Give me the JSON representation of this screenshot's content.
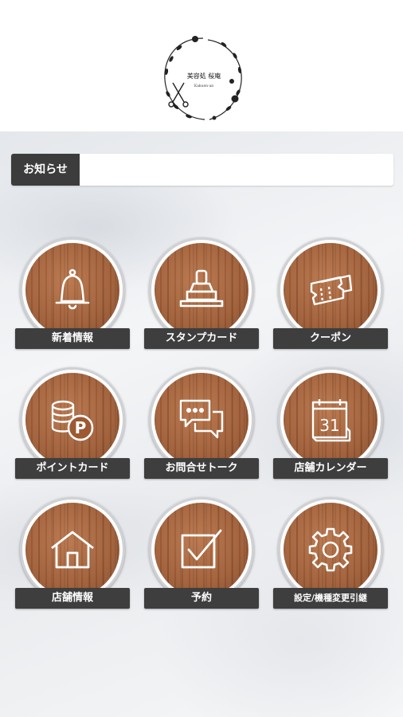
{
  "header": {
    "logo_icon": "floral-wreath-scissors-logo",
    "logo_text": "美容処 桜庵",
    "logo_subtext": "Kakuen-an"
  },
  "notice": {
    "label": "お知らせ",
    "content": ""
  },
  "menu": [
    {
      "label": "新着情報",
      "icon": "bell-icon"
    },
    {
      "label": "スタンプカード",
      "icon": "stamp-icon"
    },
    {
      "label": "クーポン",
      "icon": "coupon-icon"
    },
    {
      "label": "ポイントカード",
      "icon": "coins-point-icon"
    },
    {
      "label": "お問合せトーク",
      "icon": "chat-bubbles-icon"
    },
    {
      "label": "店舗カレンダー",
      "icon": "calendar-icon"
    },
    {
      "label": "店舗情報",
      "icon": "house-icon"
    },
    {
      "label": "予約",
      "icon": "checkbox-icon"
    },
    {
      "label": "設定/機種変更引継",
      "icon": "gear-icon"
    }
  ],
  "calendar_day": "31",
  "point_symbol": "P",
  "colors": {
    "label_bg": "#3e3e3e",
    "wood": "#9c5a33",
    "notice_label_bg": "#3c3c3c"
  }
}
